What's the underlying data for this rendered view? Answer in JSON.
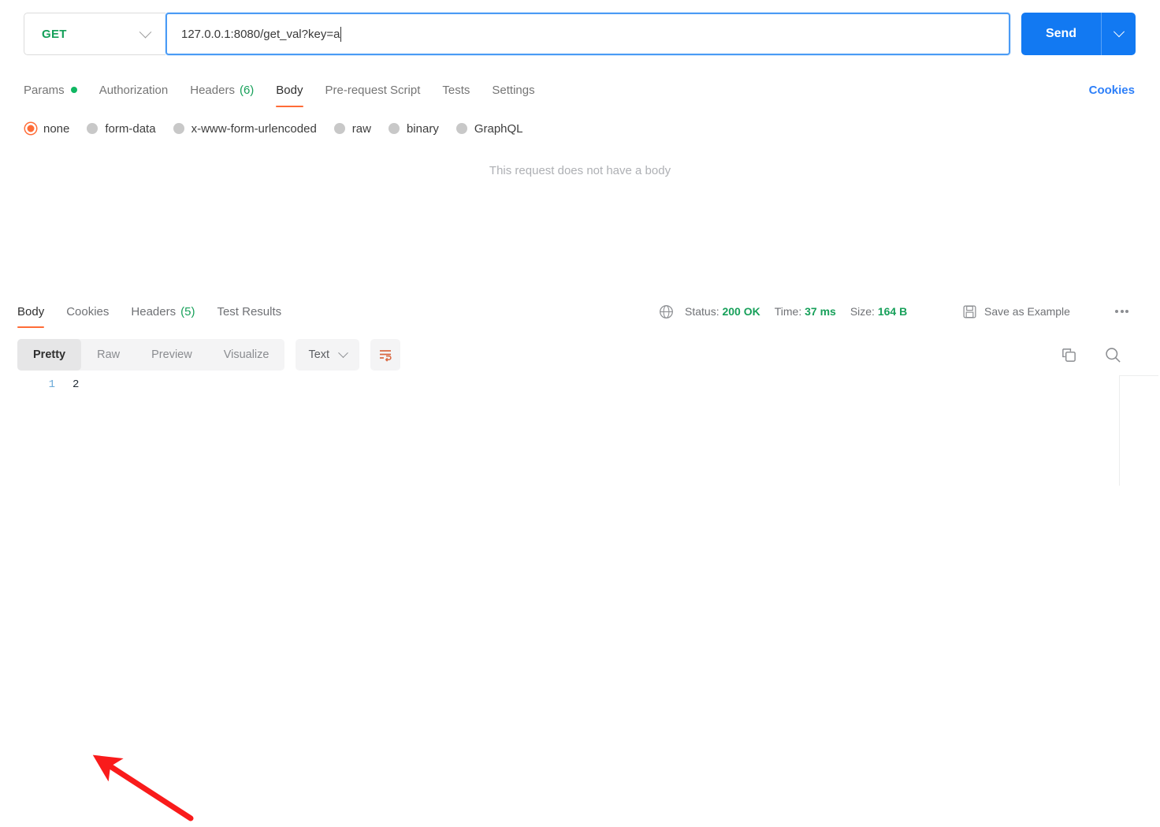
{
  "request": {
    "method": "GET",
    "url": "127.0.0.1:8080/get_val?key=a",
    "send_label": "Send",
    "tabs": [
      {
        "label": "Params",
        "badge": "",
        "dot": true,
        "active": false
      },
      {
        "label": "Authorization",
        "badge": "",
        "dot": false,
        "active": false
      },
      {
        "label": "Headers",
        "badge": "(6)",
        "dot": false,
        "active": false
      },
      {
        "label": "Body",
        "badge": "",
        "dot": false,
        "active": true
      },
      {
        "label": "Pre-request Script",
        "badge": "",
        "dot": false,
        "active": false
      },
      {
        "label": "Tests",
        "badge": "",
        "dot": false,
        "active": false
      },
      {
        "label": "Settings",
        "badge": "",
        "dot": false,
        "active": false
      }
    ],
    "cookies_link": "Cookies",
    "body_types": [
      {
        "label": "none",
        "selected": true
      },
      {
        "label": "form-data",
        "selected": false
      },
      {
        "label": "x-www-form-urlencoded",
        "selected": false
      },
      {
        "label": "raw",
        "selected": false
      },
      {
        "label": "binary",
        "selected": false
      },
      {
        "label": "GraphQL",
        "selected": false
      }
    ],
    "empty_body_message": "This request does not have a body"
  },
  "response": {
    "tabs": [
      {
        "label": "Body",
        "badge": "",
        "active": true
      },
      {
        "label": "Cookies",
        "badge": "",
        "active": false
      },
      {
        "label": "Headers",
        "badge": "(5)",
        "active": false
      },
      {
        "label": "Test Results",
        "badge": "",
        "active": false
      }
    ],
    "status": {
      "status_label": "Status:",
      "status_value": "200 OK",
      "time_label": "Time:",
      "time_value": "37 ms",
      "size_label": "Size:",
      "size_value": "164 B"
    },
    "save_as_example": "Save as Example",
    "view_modes": [
      {
        "label": "Pretty",
        "active": true
      },
      {
        "label": "Raw",
        "active": false
      },
      {
        "label": "Preview",
        "active": false
      },
      {
        "label": "Visualize",
        "active": false
      }
    ],
    "format": "Text",
    "lines": [
      {
        "number": "1",
        "content": "2"
      }
    ]
  },
  "colors": {
    "accent_orange": "#ff6c37",
    "method_green": "#15a05a",
    "send_blue": "#1279f2",
    "link_blue": "#2d7ff9",
    "status_green": "#17a05a",
    "annotation_red": "#f91b1b"
  }
}
